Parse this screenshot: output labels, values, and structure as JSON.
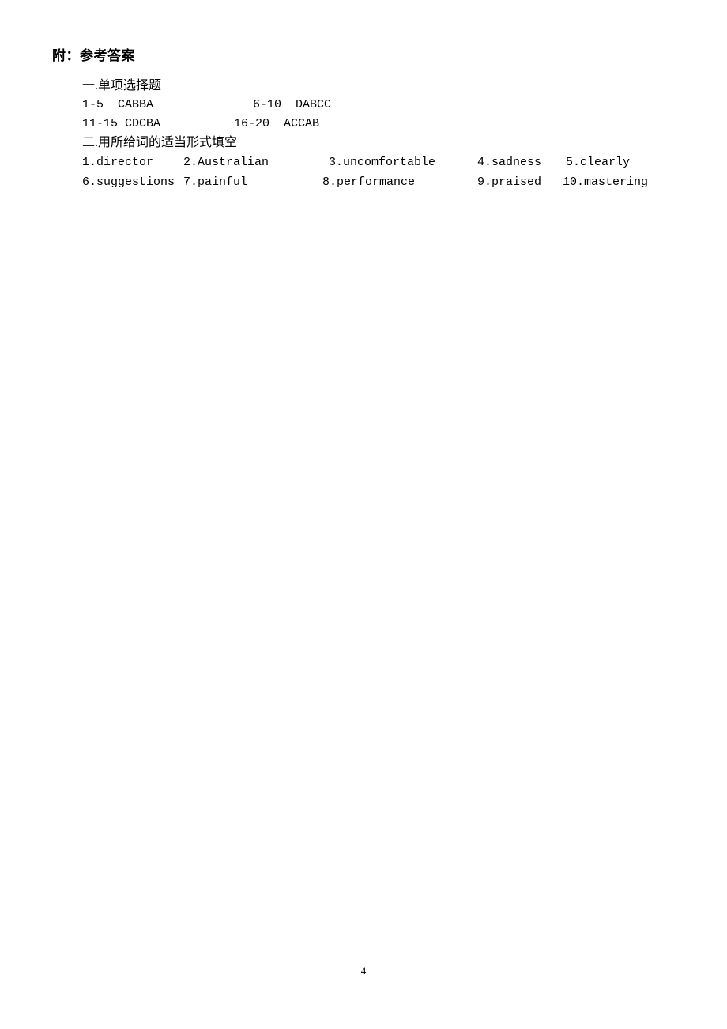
{
  "document": {
    "heading": "附：参考答案",
    "page_number": "4",
    "sections": [
      {
        "title": "一.单项选择题",
        "rows": [
          {
            "left": "1-5  CABBA",
            "right": "6-10  DABCC"
          },
          {
            "left": "11-15 CDCBA",
            "right": "16-20  ACCAB"
          }
        ]
      },
      {
        "title": "二.用所给词的适当形式填空",
        "answers_row1": [
          {
            "number": "1.",
            "word": "director"
          },
          {
            "number": "2.",
            "word": "Australian"
          },
          {
            "number": "3.",
            "word": "uncomfortable"
          },
          {
            "number": "4.",
            "word": "sadness"
          },
          {
            "number": "5.",
            "word": "clearly"
          }
        ],
        "answers_row2": [
          {
            "number": "6.",
            "word": "suggestions"
          },
          {
            "number": "7.",
            "word": "painful"
          },
          {
            "number": "8.",
            "word": "performance"
          },
          {
            "number": "9.",
            "word": "praised"
          },
          {
            "number": "10.",
            "word": "mastering"
          }
        ]
      }
    ],
    "cells_row1": [
      "1.director",
      "2.Australian",
      "3.uncomfortable",
      "4.sadness",
      "5.clearly"
    ],
    "cells_row2": [
      "6.suggestions",
      "7.painful",
      "8.performance",
      "9.praised",
      "10.mastering"
    ]
  }
}
